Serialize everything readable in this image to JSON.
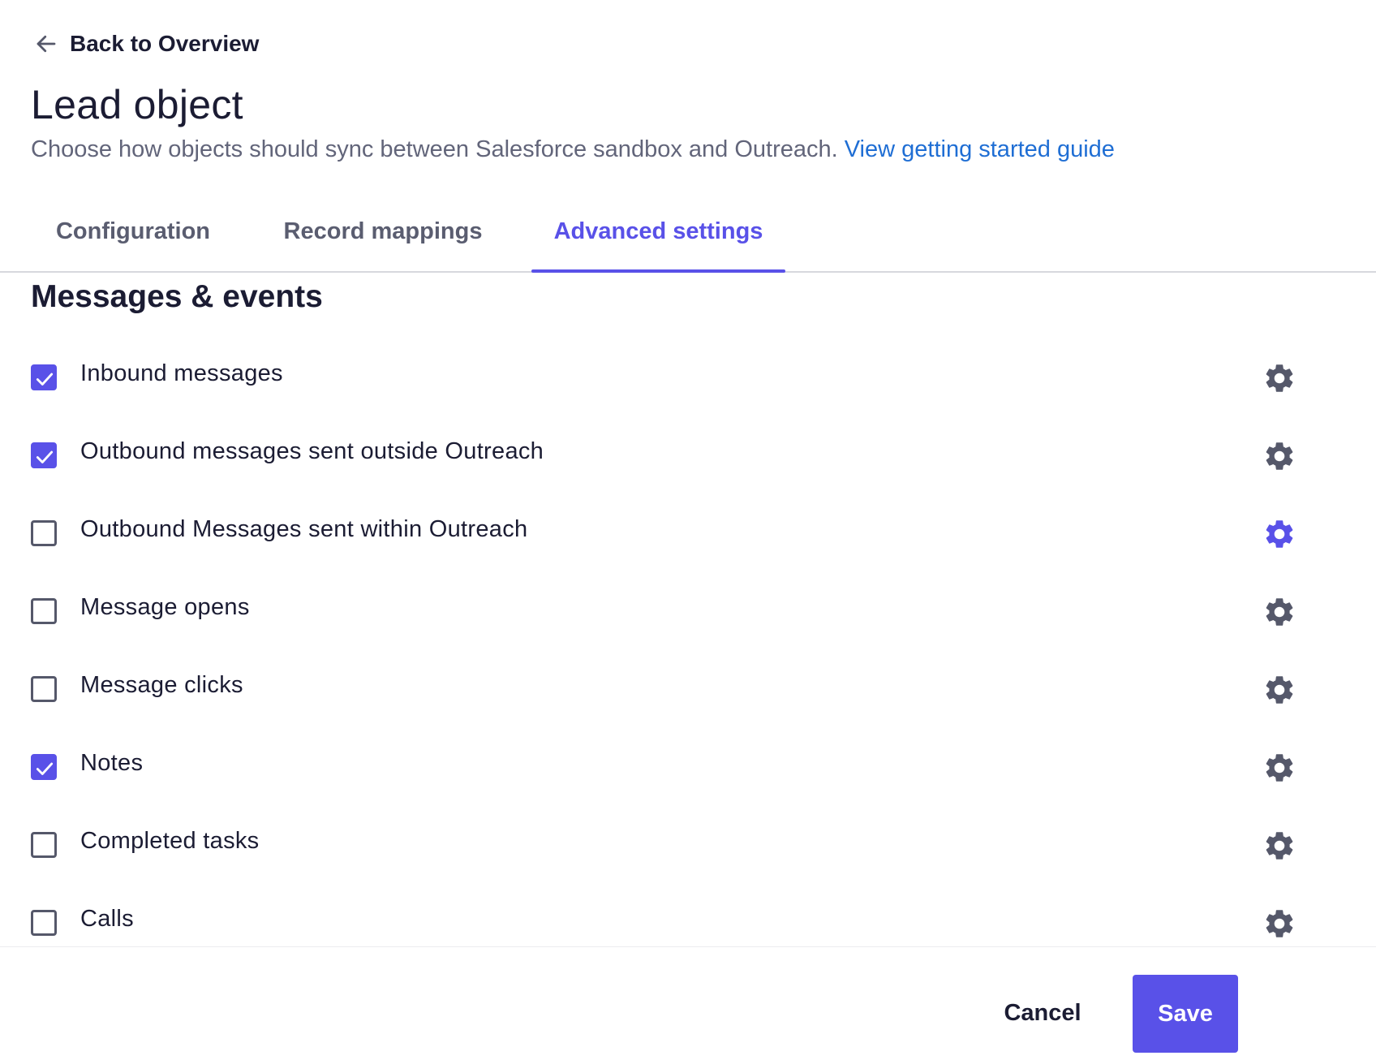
{
  "nav": {
    "back_label": "Back to Overview",
    "back_icon": "arrow-left-icon"
  },
  "header": {
    "title": "Lead object",
    "description": "Choose how objects should sync between Salesforce sandbox and Outreach.",
    "guide_link": "View getting started guide"
  },
  "tabs": [
    {
      "label": "Configuration",
      "active": false
    },
    {
      "label": "Record mappings",
      "active": false
    },
    {
      "label": "Advanced settings",
      "active": true
    }
  ],
  "section": {
    "title": "Messages & events",
    "items": [
      {
        "label": "Inbound messages",
        "checked": true,
        "settings_icon": "gear-icon"
      },
      {
        "label": "Outbound messages sent outside Outreach",
        "checked": true,
        "settings_icon": "gear-icon"
      },
      {
        "label": "Outbound Messages sent within Outreach",
        "checked": false,
        "settings_icon": "gear-icon",
        "settings_highlighted": true
      },
      {
        "label": "Message opens",
        "checked": false,
        "settings_icon": "gear-icon"
      },
      {
        "label": "Message clicks",
        "checked": false,
        "settings_icon": "gear-icon"
      },
      {
        "label": "Notes",
        "checked": true,
        "settings_icon": "gear-icon"
      },
      {
        "label": "Completed tasks",
        "checked": false,
        "settings_icon": "gear-icon"
      },
      {
        "label": "Calls",
        "checked": false,
        "settings_icon": "gear-icon"
      }
    ]
  },
  "footer": {
    "cancel_label": "Cancel",
    "save_label": "Save"
  },
  "colors": {
    "accent": "#5951e8",
    "link": "#1f6ed4",
    "text_primary": "#1b1c33",
    "text_secondary": "#62657a",
    "icon_default": "#55586a"
  }
}
